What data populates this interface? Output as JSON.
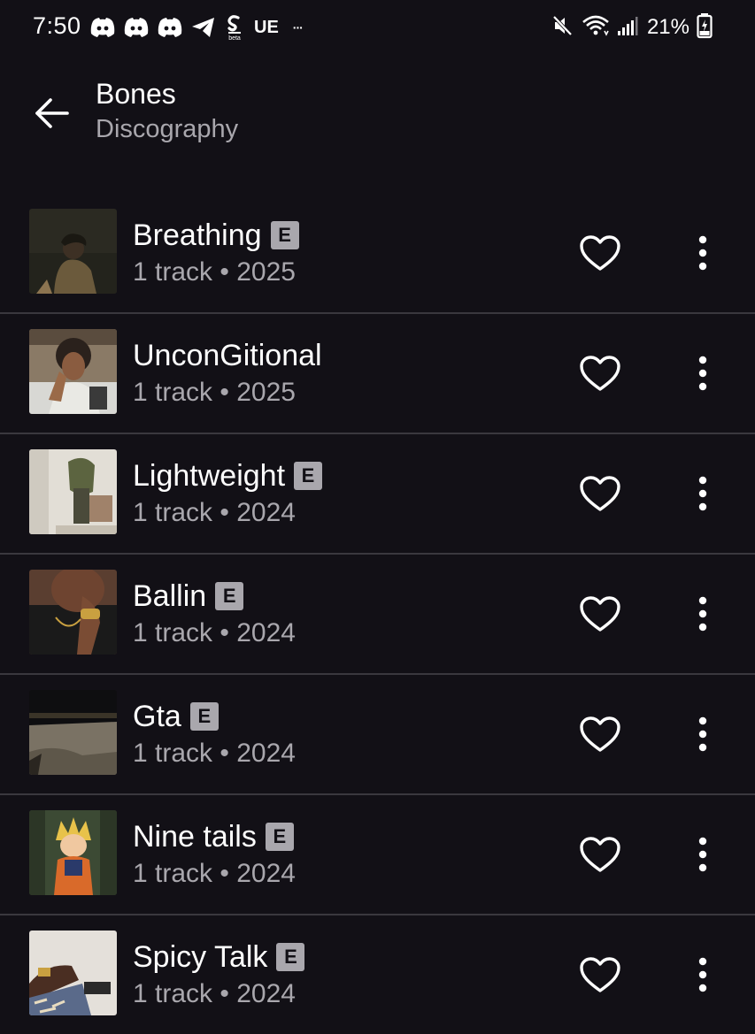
{
  "status_bar": {
    "time": "7:50",
    "ue_label": "UE",
    "more_label": "···",
    "battery_percent": "21%",
    "icons": [
      "discord-icon",
      "discord-icon",
      "discord-icon",
      "telegram-icon",
      "shazam-beta-icon",
      "mute-icon",
      "wifi-icon",
      "signal-icon",
      "battery-icon"
    ]
  },
  "header": {
    "title": "Bones",
    "subtitle": "Discography"
  },
  "tracks": [
    {
      "title": "Breathing",
      "explicit_label": "E",
      "meta": "1 track • 2025"
    },
    {
      "title": "UnconGitional",
      "explicit_label": "",
      "meta": "1 track • 2025"
    },
    {
      "title": "Lightweight",
      "explicit_label": "E",
      "meta": "1 track • 2024"
    },
    {
      "title": "Ballin",
      "explicit_label": "E",
      "meta": "1 track • 2024"
    },
    {
      "title": "Gta",
      "explicit_label": "E",
      "meta": "1 track • 2024"
    },
    {
      "title": "Nine tails",
      "explicit_label": "E",
      "meta": "1 track • 2024"
    },
    {
      "title": "Spicy Talk",
      "explicit_label": "E",
      "meta": "1 track • 2024"
    }
  ],
  "colors": {
    "background": "#121016",
    "text_primary": "#ffffff",
    "text_secondary": "#a9a7ad",
    "divider": "#3a383e",
    "explicit_badge": "#a9a7ad"
  }
}
